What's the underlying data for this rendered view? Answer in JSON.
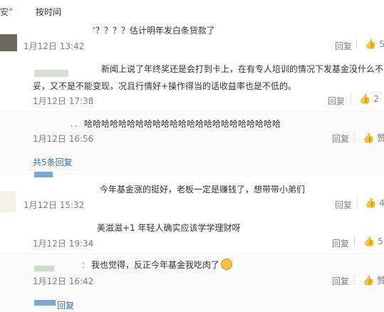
{
  "header": {
    "fragment_left": "安”",
    "sort_label": "按时间"
  },
  "comments": [
    {
      "text": "’？？？？估计明年发白条贷款了",
      "time": "1月12日 13:42",
      "reply_label": "回复",
      "likes": "5"
    },
    {
      "text_line1": "新闻上说了年终奖还是会打到卡上，在有专人培训的情况下发基金没什么不",
      "text_line2": "妥，又不是不能变现，况且行情好+操作得当的话收益率也是不低的。",
      "time": "1月12日 17:38",
      "reply_label": "回复",
      "likes": "2"
    },
    {
      "prefix": "．．",
      "text": "哈哈哈哈哈哈哈哈哈哈哈哈哈哈哈哈哈哈哈哈哈哈哈",
      "time": "1月12日 16:56",
      "reply_label": "回复",
      "likes": "赞",
      "expand_replies": "共5条回复"
    },
    {
      "text": "今年基金涨的挺好，老板一定是赚钱了，想带带小弟们",
      "time": "1月12日 15:32",
      "reply_label": "回复",
      "likes": "4"
    },
    {
      "text": "美滋滋+1 年轻人确实应该学学理财呀",
      "time": "1月12日 19:34",
      "reply_label": "回复",
      "likes": "5"
    },
    {
      "prefix": "：",
      "text": "我也觉得，反正今年基金我吃肉了",
      "time": "1月12日 16:42",
      "reply_label": "回复",
      "likes": "赞",
      "expand_replies": "回复"
    }
  ],
  "icons": {
    "like": "thumbs-up-icon",
    "emoji": "smiling-face-icon"
  },
  "colors": {
    "text": "#333333",
    "meta": "#808080",
    "link": "#eb7350",
    "band": "#fafafa"
  }
}
